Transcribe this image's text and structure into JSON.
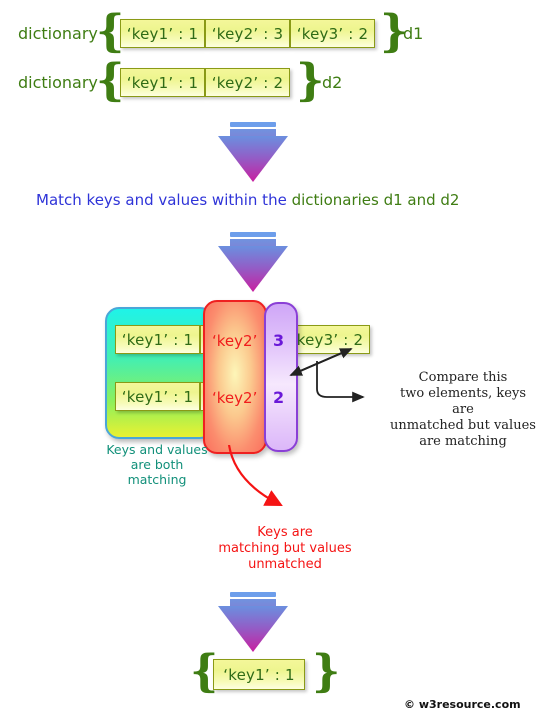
{
  "title": "Match keys and values within dictionaries diagram",
  "inputs": [
    {
      "label": "dictionary",
      "name": "d1",
      "open_brace": "{",
      "close_brace": "}",
      "cells": [
        "‘key1’ : 1",
        "‘key2’ : 3",
        "‘key3’ : 2"
      ]
    },
    {
      "label": "dictionary",
      "name": "d2",
      "open_brace": "{",
      "close_brace": "}",
      "cells": [
        "‘key1’ : 1",
        "‘key2’ : 2"
      ]
    }
  ],
  "step_text": {
    "part1": "Match keys and values within the ",
    "part2": "dictionaries d1 and d2"
  },
  "comparison": {
    "row1": {
      "key1": "‘key1’ : 1",
      "key2": "‘key2’",
      "colon": ":",
      "value": "3",
      "key3": "‘key3’ : 2"
    },
    "row2": {
      "key1": "‘key1’ : 1",
      "key2": "‘key2’",
      "colon": ":",
      "value": "2"
    },
    "note_green": "Keys and values\nare both\nmatching",
    "note_green_lines": [
      "Keys and values",
      "are both",
      "matching"
    ],
    "note_red_lines": [
      "Keys are",
      "matching but values",
      "unmatched"
    ],
    "note_black_lines": [
      "Compare this",
      "two elements, keys are",
      "unmatched but values",
      "are matching"
    ]
  },
  "result": {
    "open_brace": "{",
    "close_brace": "}",
    "cell": "‘key1’ : 1"
  },
  "footer": "© w3resource.com",
  "colors": {
    "cell_border": "#8a9a16",
    "cell_text": "#2f6b16",
    "brace": "#3f7d13",
    "highlight_match": "#1ff3e8",
    "highlight_key": "#ef2020",
    "highlight_value": "#8a3fd6",
    "note_green": "#12907a",
    "note_red": "#f51414",
    "step_blue": "#2f34d8",
    "step_green": "#3f7d13",
    "arrow_top": "#6d9eeb",
    "arrow_bottom": "#c81fa0"
  }
}
